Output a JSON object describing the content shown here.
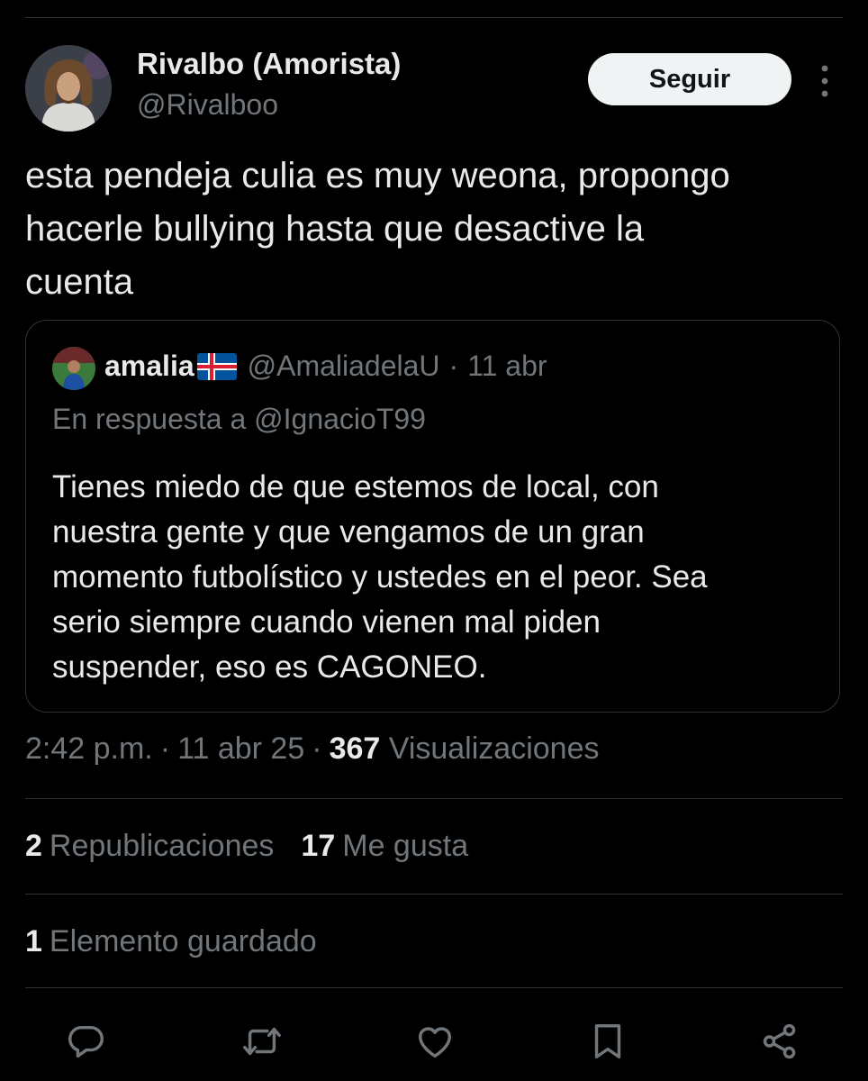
{
  "tweet": {
    "author_name": "Rivalbo (Amorista)",
    "author_handle": "@Rivalboo",
    "follow_label": "Seguir",
    "text": "esta pendeja culia es muy weona, propongo\nhacerle bullying hasta que desactive la\ncuenta"
  },
  "quote": {
    "name": "amalia",
    "flag": "iceland-flag",
    "handle": "@AmaliadelaU",
    "separator": "·",
    "date": "11 abr",
    "reply_to": "En respuesta a @IgnacioT99",
    "text": "Tienes miedo de que estemos de local, con\nnuestra gente y que vengamos de un gran\nmomento futbolístico y ustedes en el peor. Sea\nserio siempre cuando vienen mal piden\nsuspender, eso es CAGONEO."
  },
  "meta": {
    "time": "2:42 p.m.",
    "separator": "·",
    "date": "11 abr 25",
    "views_count": "367",
    "views_label": "Visualizaciones"
  },
  "stats": {
    "reposts_count": "2",
    "reposts_label": "Republicaciones",
    "likes_count": "17",
    "likes_label": "Me gusta",
    "bookmarks_count": "1",
    "bookmarks_label": "Elemento guardado"
  },
  "actions": [
    "reply-icon",
    "repost-icon",
    "like-icon",
    "bookmark-icon",
    "share-icon"
  ],
  "colors": {
    "background": "#000000",
    "text_primary": "#e7e9ea",
    "text_secondary": "#71767b",
    "divider": "#2f3336",
    "follow_button_bg": "#eff3f4"
  }
}
